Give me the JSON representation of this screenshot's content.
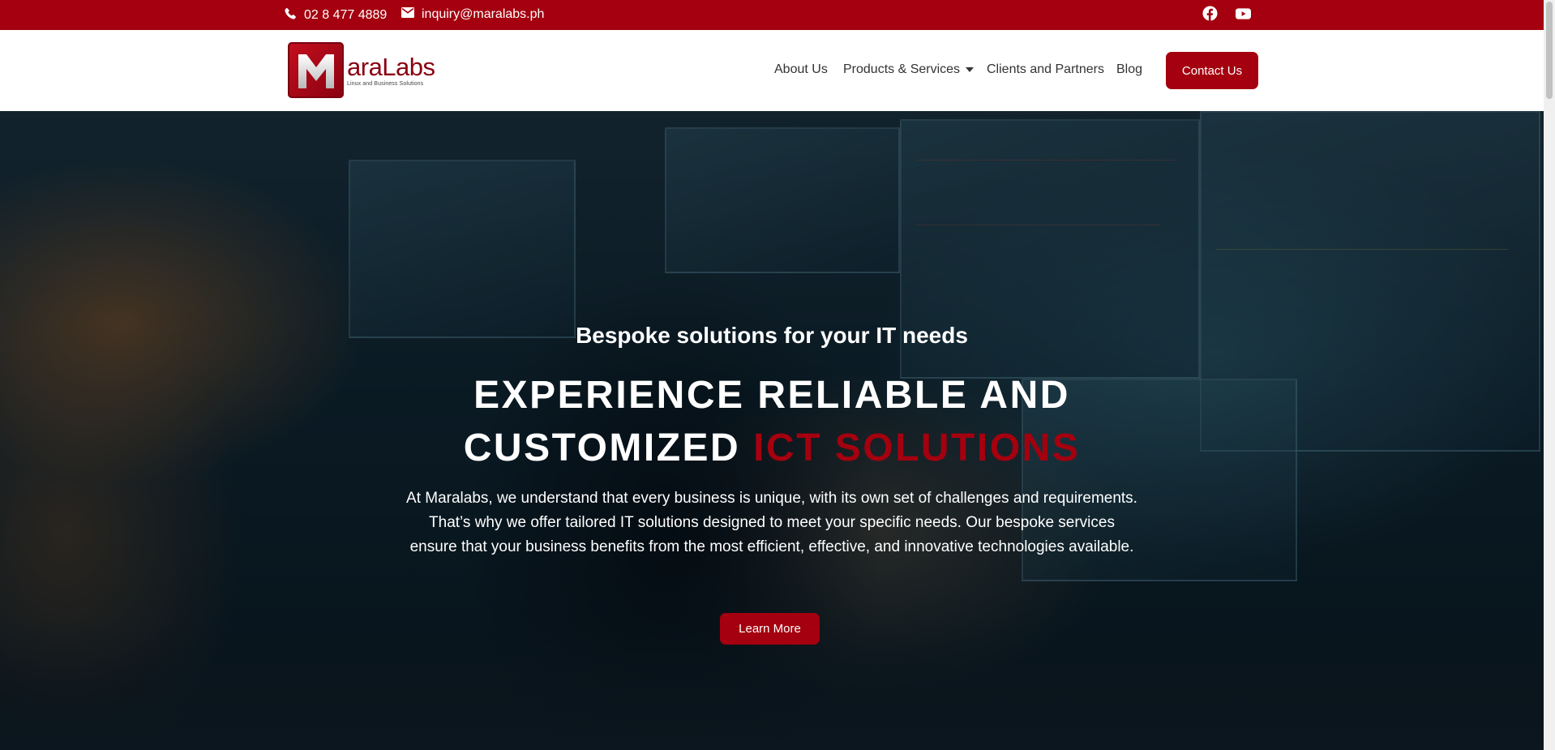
{
  "topbar": {
    "phone": "02 8 477 4889",
    "email": "inquiry@maralabs.ph",
    "icons": [
      "phone-icon",
      "envelope-icon",
      "facebook-icon",
      "youtube-icon"
    ]
  },
  "brand": {
    "logo_letter": "M",
    "logo_word": "araLabs",
    "tagline": "Linux and Business Solutions"
  },
  "nav": {
    "about": "About Us",
    "products": "Products & Services",
    "clients": "Clients and Partners",
    "blog": "Blog",
    "contact": "Contact Us"
  },
  "hero": {
    "subtitle": "Bespoke solutions for your IT needs",
    "title_line1": "EXPERIENCE RELIABLE AND",
    "title_line2_white": "CUSTOMIZED",
    "title_line2_accent": "ICT SOLUTIONS",
    "description": "At Maralabs, we understand that every business is unique, with its own set of challenges and requirements. That’s why we offer tailored IT solutions designed to meet your specific needs. Our bespoke services ensure that your business benefits from the most efficient, effective, and innovative technologies available.",
    "cta": "Learn More"
  },
  "colors": {
    "brand_red": "#a4000f",
    "white": "#ffffff",
    "nav_text": "#333333"
  }
}
